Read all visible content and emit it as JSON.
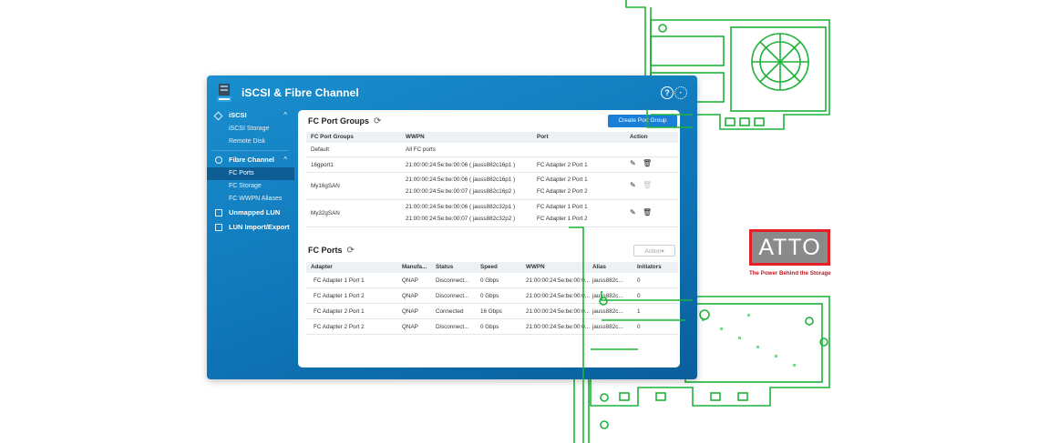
{
  "window": {
    "title": "iSCSI & Fibre Channel"
  },
  "sidebar": {
    "groups": [
      {
        "label": "iSCSI",
        "chevron": "^",
        "items": [
          {
            "label": "iSCSI Storage"
          },
          {
            "label": "Remote Disk"
          }
        ]
      },
      {
        "label": "Fibre Channel",
        "chevron": "^",
        "items": [
          {
            "label": "FC Ports",
            "active": true
          },
          {
            "label": "FC Storage"
          },
          {
            "label": "FC WWPN Aliases"
          }
        ]
      },
      {
        "label": "Unmapped LUN",
        "items": []
      },
      {
        "label": "LUN Import/Export",
        "items": []
      }
    ]
  },
  "port_groups": {
    "title": "FC Port Groups",
    "create_button": "Create Port Group",
    "columns": [
      "FC Port Groups",
      "WWPN",
      "Port",
      "Action"
    ],
    "rows": [
      {
        "name": "Default",
        "wwpn": [
          "All FC ports"
        ],
        "port": [
          ""
        ],
        "actions": "none"
      },
      {
        "name": "16gport1",
        "wwpn": [
          "21:00:00:24:5e:be:00:06 ( jauss882c16p1 )"
        ],
        "port": [
          "FC Adapter 2 Port 1"
        ],
        "actions": "edit-delete"
      },
      {
        "name": "My16gSAN",
        "wwpn": [
          "21:00:00:24:5e:be:00:06 ( jauss882c16p1 )",
          "21:00:00:24:5e:be:00:07 ( jauss882c16p2 )"
        ],
        "port": [
          "FC Adapter 2 Port 1",
          "FC Adapter 2 Port 2"
        ],
        "actions": "edit-delete-disabled"
      },
      {
        "name": "My32gSAN",
        "wwpn": [
          "21:00:00:24:5e:be:00:06 ( jauss882c32p1 )",
          "21:00:00:24:5e:be:00:07 ( jauss882c32p2 )"
        ],
        "port": [
          "FC Adapter 1 Port 1",
          "FC Adapter 1 Port 2"
        ],
        "actions": "edit-delete"
      }
    ]
  },
  "fc_ports": {
    "title": "FC Ports",
    "action_button": "Action▾",
    "columns": [
      "Adapter",
      "Manufa...",
      "Status",
      "Speed",
      "WWPN",
      "Alias",
      "Initiators"
    ],
    "rows": [
      {
        "adapter": "FC Adapter 1 Port 1",
        "manufacturer": "QNAP",
        "status": "Disconnect...",
        "speed": "0 Gbps",
        "wwpn": "21:00:00:24:5e:be:00:0...",
        "alias": "jauss882c...",
        "initiators": "0"
      },
      {
        "adapter": "FC Adapter 1 Port 2",
        "manufacturer": "QNAP",
        "status": "Disconnect...",
        "speed": "0 Gbps",
        "wwpn": "21:00:00:24:5e:be:00:0...",
        "alias": "jauss882c...",
        "initiators": "0"
      },
      {
        "adapter": "FC Adapter 2 Port 1",
        "manufacturer": "QNAP",
        "status": "Connected",
        "speed": "16 Gbps",
        "wwpn": "21:00:00:24:5e:be:00:0...",
        "alias": "jauss882c...",
        "initiators": "1"
      },
      {
        "adapter": "FC Adapter 2 Port 2",
        "manufacturer": "QNAP",
        "status": "Disconnect...",
        "speed": "0 Gbps",
        "wwpn": "21:00:00:24:5e:be:00:0...",
        "alias": "jauss882c...",
        "initiators": "0"
      }
    ]
  },
  "brand": {
    "logo_text": "ATTO",
    "tagline": "The Power Behind the Storage",
    "logo_color": "#e31e24",
    "logo_text_color": "#ffffff",
    "logo_box_color": "#8a8a8a"
  },
  "colors": {
    "window": "#1a8fce",
    "accent": "#1a7fd6",
    "card_outline": "#1db339"
  }
}
